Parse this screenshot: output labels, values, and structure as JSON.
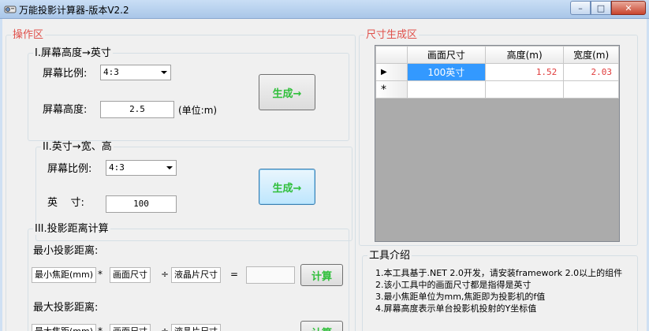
{
  "window": {
    "title": "万能投影计算器-版本V2.2",
    "min": "–",
    "max": "□",
    "close": "✕"
  },
  "left_group": {
    "title": "操作区"
  },
  "section1": {
    "title": "I.屏幕高度→英寸",
    "ratio_label": "屏幕比例:",
    "ratio_value": "4:3",
    "height_label": "屏幕高度:",
    "height_value": "2.5",
    "unit": "(单位:m)",
    "generate": "生成→"
  },
  "section2": {
    "title": "II.英寸→宽、高",
    "ratio_label": "屏幕比例:",
    "ratio_value": "4:3",
    "inch_label": "英    寸:",
    "inch_value": "100",
    "generate": "生成→"
  },
  "section3": {
    "title": "III.投影距离计算",
    "min_label": "最小投影距离:",
    "max_label": "最大投影距离:",
    "min_focal": "最小焦距(mm)",
    "screen_size": "画面尺寸",
    "lcd_size": "液晶片尺寸",
    "times": "*",
    "divide": "÷",
    "equals": "=",
    "calc": "计算",
    "max_focal": "最大焦距(mm)"
  },
  "right_group": {
    "title": "尺寸生成区"
  },
  "grid": {
    "headers": [
      "画面尺寸",
      "高度(m)",
      "宽度(m)"
    ],
    "rows": [
      {
        "marker": "▶",
        "size": "100英寸",
        "height": "1.52",
        "width": "2.03"
      }
    ],
    "new_row_marker": "*"
  },
  "intro": {
    "title": "工具介绍",
    "items": [
      "1.本工具基于.NET 2.0开发，请安装framework 2.0以上的组件",
      "2.该小工具中的画面尺寸都是指得是英寸",
      "3.最小焦距单位为mm,焦距即为投影机的f值",
      "4.屏幕高度表示单台投影机投射的Y坐标值"
    ]
  }
}
